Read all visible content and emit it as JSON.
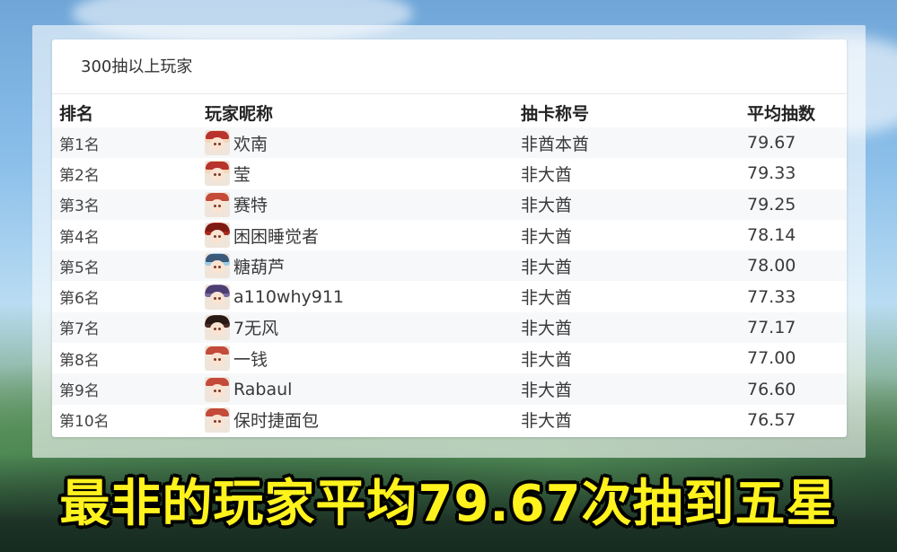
{
  "card": {
    "title": "300抽以上玩家"
  },
  "table": {
    "headers": {
      "rank": "排名",
      "name": "玩家昵称",
      "title": "抽卡称号",
      "avg": "平均抽数"
    },
    "rows": [
      {
        "rank": "第1名",
        "name": "欢南",
        "title": "非酋本酋",
        "avg": "79.67",
        "avatar": "klee-avatar"
      },
      {
        "rank": "第2名",
        "name": "莹",
        "title": "非大酋",
        "avg": "79.33",
        "avatar": "klee-avatar"
      },
      {
        "rank": "第3名",
        "name": "赛特",
        "title": "非大酋",
        "avg": "79.25",
        "avatar": "kazuha-avatar"
      },
      {
        "rank": "第4名",
        "name": "困困睡觉者",
        "title": "非大酋",
        "avg": "78.14",
        "avatar": "diluc-avatar"
      },
      {
        "rank": "第5名",
        "name": "糖葫芦",
        "title": "非大酋",
        "avg": "78.00",
        "avatar": "eula-avatar"
      },
      {
        "rank": "第6名",
        "name": "a110why911",
        "title": "非大酋",
        "avg": "77.33",
        "avatar": "keqing-avatar"
      },
      {
        "rank": "第7名",
        "name": "7无风",
        "title": "非大酋",
        "avg": "77.17",
        "avatar": "hutao-avatar"
      },
      {
        "rank": "第8名",
        "name": "一钱",
        "title": "非大酋",
        "avg": "77.00",
        "avatar": "kazuha-avatar"
      },
      {
        "rank": "第9名",
        "name": "Rabaul",
        "title": "非大酋",
        "avg": "76.60",
        "avatar": "kazuha-avatar"
      },
      {
        "rank": "第10名",
        "name": "保时捷面包",
        "title": "非大酋",
        "avg": "76.57",
        "avatar": "kazuha-avatar"
      }
    ]
  },
  "caption": "最非的玩家平均79.67次抽到五星",
  "colors": {
    "caption_fill": "#fff21d",
    "caption_stroke": "#000000",
    "row_stripe": "#f7f8fa"
  }
}
